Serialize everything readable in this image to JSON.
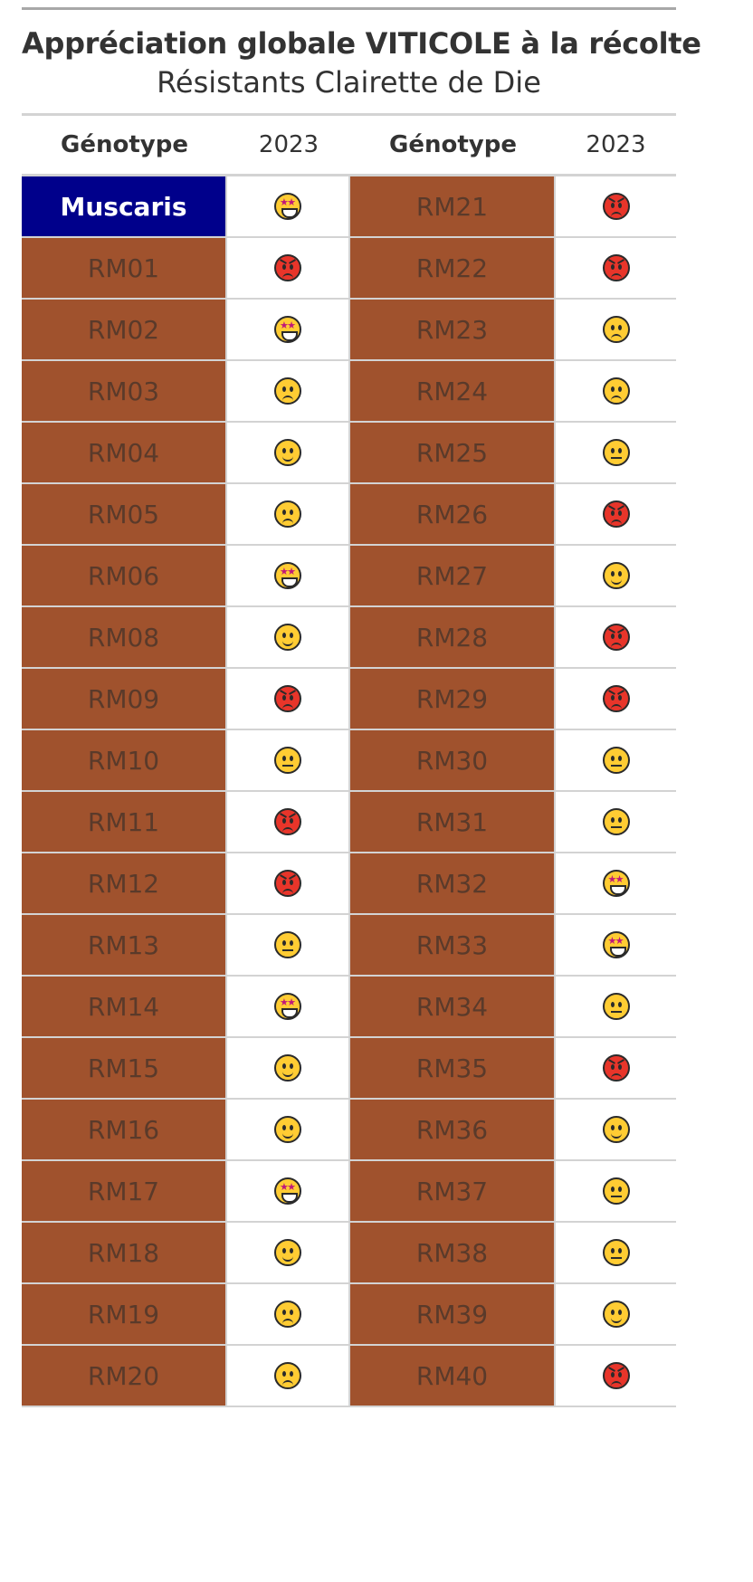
{
  "title": "Appréciation globale VITICOLE à la récolte",
  "subtitle": "Résistants Clairette de Die",
  "columns": {
    "genotype_label": "Génotype",
    "year_label": "2023"
  },
  "colors": {
    "reference_bg": "#00008b",
    "genotype_bg": "#a0522d",
    "grid": "#d3d3d3"
  },
  "left": [
    {
      "genotype": "Muscaris",
      "rating": "star-struck-icon",
      "reference": true
    },
    {
      "genotype": "RM01",
      "rating": "angry-face-icon"
    },
    {
      "genotype": "RM02",
      "rating": "star-struck-icon"
    },
    {
      "genotype": "RM03",
      "rating": "slightly-frowning-face-icon"
    },
    {
      "genotype": "RM04",
      "rating": "slightly-smiling-face-icon"
    },
    {
      "genotype": "RM05",
      "rating": "slightly-frowning-face-icon"
    },
    {
      "genotype": "RM06",
      "rating": "star-struck-icon"
    },
    {
      "genotype": "RM08",
      "rating": "slightly-smiling-face-icon"
    },
    {
      "genotype": "RM09",
      "rating": "angry-face-icon"
    },
    {
      "genotype": "RM10",
      "rating": "neutral-face-icon"
    },
    {
      "genotype": "RM11",
      "rating": "angry-face-icon"
    },
    {
      "genotype": "RM12",
      "rating": "angry-face-icon"
    },
    {
      "genotype": "RM13",
      "rating": "neutral-face-icon"
    },
    {
      "genotype": "RM14",
      "rating": "star-struck-icon"
    },
    {
      "genotype": "RM15",
      "rating": "slightly-smiling-face-icon"
    },
    {
      "genotype": "RM16",
      "rating": "slightly-smiling-face-icon"
    },
    {
      "genotype": "RM17",
      "rating": "star-struck-icon"
    },
    {
      "genotype": "RM18",
      "rating": "slightly-smiling-face-icon"
    },
    {
      "genotype": "RM19",
      "rating": "slightly-frowning-face-icon"
    },
    {
      "genotype": "RM20",
      "rating": "slightly-frowning-face-icon"
    }
  ],
  "right": [
    {
      "genotype": "RM21",
      "rating": "angry-face-icon"
    },
    {
      "genotype": "RM22",
      "rating": "angry-face-icon"
    },
    {
      "genotype": "RM23",
      "rating": "slightly-frowning-face-icon"
    },
    {
      "genotype": "RM24",
      "rating": "slightly-frowning-face-icon"
    },
    {
      "genotype": "RM25",
      "rating": "neutral-face-icon"
    },
    {
      "genotype": "RM26",
      "rating": "angry-face-icon"
    },
    {
      "genotype": "RM27",
      "rating": "slightly-smiling-face-icon"
    },
    {
      "genotype": "RM28",
      "rating": "angry-face-icon"
    },
    {
      "genotype": "RM29",
      "rating": "angry-face-icon"
    },
    {
      "genotype": "RM30",
      "rating": "neutral-face-icon"
    },
    {
      "genotype": "RM31",
      "rating": "neutral-face-icon"
    },
    {
      "genotype": "RM32",
      "rating": "star-struck-icon"
    },
    {
      "genotype": "RM33",
      "rating": "star-struck-icon"
    },
    {
      "genotype": "RM34",
      "rating": "neutral-face-icon"
    },
    {
      "genotype": "RM35",
      "rating": "angry-face-icon"
    },
    {
      "genotype": "RM36",
      "rating": "slightly-smiling-face-icon"
    },
    {
      "genotype": "RM37",
      "rating": "neutral-face-icon"
    },
    {
      "genotype": "RM38",
      "rating": "neutral-face-icon"
    },
    {
      "genotype": "RM39",
      "rating": "slightly-smiling-face-icon"
    },
    {
      "genotype": "RM40",
      "rating": "angry-face-icon"
    }
  ]
}
